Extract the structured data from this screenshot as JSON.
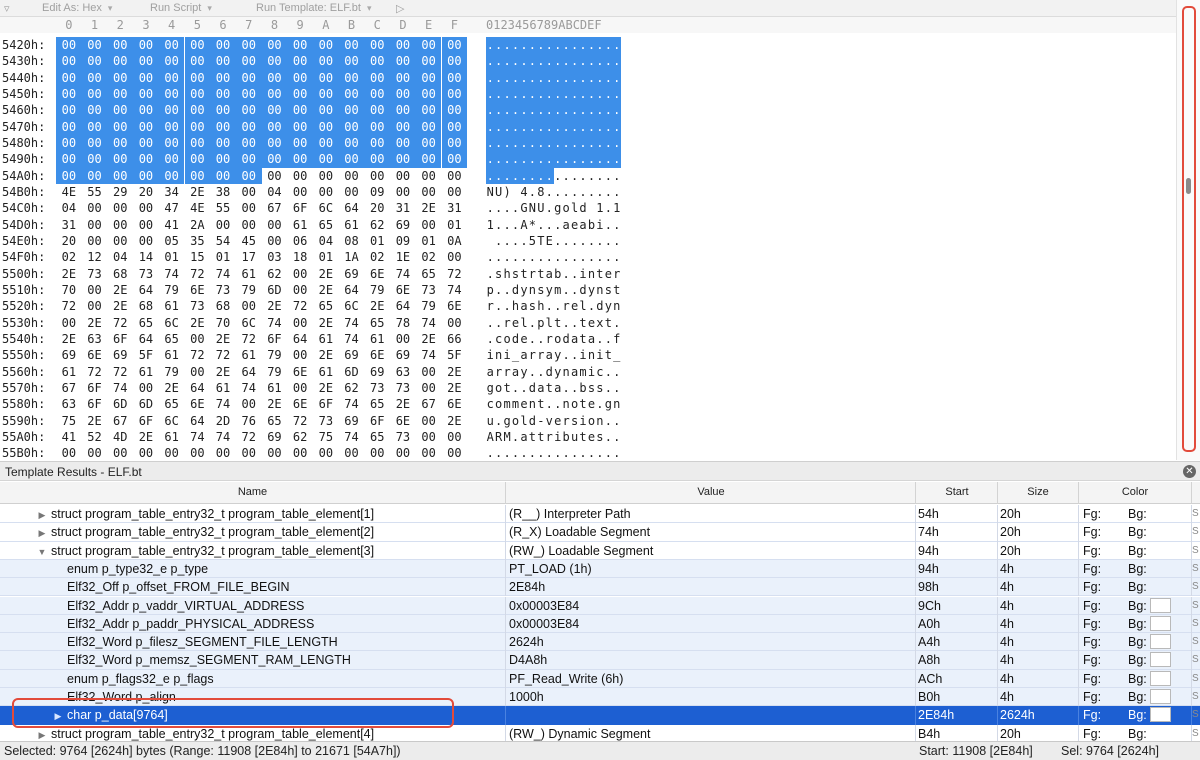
{
  "toolbar": {
    "menu_icon": "menu-arrow-icon",
    "edit_as": "Edit As: Hex",
    "run_script": "Run Script",
    "run_template": "Run Template: ELF.bt",
    "play_icon": "play-icon"
  },
  "hex": {
    "column_headers": [
      "0",
      "1",
      "2",
      "3",
      "4",
      "5",
      "6",
      "7",
      "8",
      "9",
      "A",
      "B",
      "C",
      "D",
      "E",
      "F"
    ],
    "ascii_header": "0123456789ABCDEF",
    "selection_color": "#3d8fe9",
    "rows": [
      {
        "addr": "5420h:",
        "bytes": [
          "00",
          "00",
          "00",
          "00",
          "00",
          "00",
          "00",
          "00",
          "00",
          "00",
          "00",
          "00",
          "00",
          "00",
          "00",
          "00"
        ],
        "ascii": "................",
        "sel_from": 0,
        "sel_to": 16
      },
      {
        "addr": "5430h:",
        "bytes": [
          "00",
          "00",
          "00",
          "00",
          "00",
          "00",
          "00",
          "00",
          "00",
          "00",
          "00",
          "00",
          "00",
          "00",
          "00",
          "00"
        ],
        "ascii": "................",
        "sel_from": 0,
        "sel_to": 16
      },
      {
        "addr": "5440h:",
        "bytes": [
          "00",
          "00",
          "00",
          "00",
          "00",
          "00",
          "00",
          "00",
          "00",
          "00",
          "00",
          "00",
          "00",
          "00",
          "00",
          "00"
        ],
        "ascii": "................",
        "sel_from": 0,
        "sel_to": 16
      },
      {
        "addr": "5450h:",
        "bytes": [
          "00",
          "00",
          "00",
          "00",
          "00",
          "00",
          "00",
          "00",
          "00",
          "00",
          "00",
          "00",
          "00",
          "00",
          "00",
          "00"
        ],
        "ascii": "................",
        "sel_from": 0,
        "sel_to": 16
      },
      {
        "addr": "5460h:",
        "bytes": [
          "00",
          "00",
          "00",
          "00",
          "00",
          "00",
          "00",
          "00",
          "00",
          "00",
          "00",
          "00",
          "00",
          "00",
          "00",
          "00"
        ],
        "ascii": "................",
        "sel_from": 0,
        "sel_to": 16
      },
      {
        "addr": "5470h:",
        "bytes": [
          "00",
          "00",
          "00",
          "00",
          "00",
          "00",
          "00",
          "00",
          "00",
          "00",
          "00",
          "00",
          "00",
          "00",
          "00",
          "00"
        ],
        "ascii": "................",
        "sel_from": 0,
        "sel_to": 16
      },
      {
        "addr": "5480h:",
        "bytes": [
          "00",
          "00",
          "00",
          "00",
          "00",
          "00",
          "00",
          "00",
          "00",
          "00",
          "00",
          "00",
          "00",
          "00",
          "00",
          "00"
        ],
        "ascii": "................",
        "sel_from": 0,
        "sel_to": 16
      },
      {
        "addr": "5490h:",
        "bytes": [
          "00",
          "00",
          "00",
          "00",
          "00",
          "00",
          "00",
          "00",
          "00",
          "00",
          "00",
          "00",
          "00",
          "00",
          "00",
          "00"
        ],
        "ascii": "................",
        "sel_from": 0,
        "sel_to": 16
      },
      {
        "addr": "54A0h:",
        "bytes": [
          "00",
          "00",
          "00",
          "00",
          "00",
          "00",
          "00",
          "00",
          "00",
          "00",
          "00",
          "00",
          "00",
          "00",
          "00",
          "00"
        ],
        "ascii": "................",
        "sel_from": 0,
        "sel_to": 8
      },
      {
        "addr": "54B0h:",
        "bytes": [
          "4E",
          "55",
          "29",
          "20",
          "34",
          "2E",
          "38",
          "00",
          "04",
          "00",
          "00",
          "00",
          "09",
          "00",
          "00",
          "00"
        ],
        "ascii": "NU) 4.8.........",
        "sel_from": 0,
        "sel_to": 0
      },
      {
        "addr": "54C0h:",
        "bytes": [
          "04",
          "00",
          "00",
          "00",
          "47",
          "4E",
          "55",
          "00",
          "67",
          "6F",
          "6C",
          "64",
          "20",
          "31",
          "2E",
          "31"
        ],
        "ascii": "....GNU.gold 1.1",
        "sel_from": 0,
        "sel_to": 0
      },
      {
        "addr": "54D0h:",
        "bytes": [
          "31",
          "00",
          "00",
          "00",
          "41",
          "2A",
          "00",
          "00",
          "00",
          "61",
          "65",
          "61",
          "62",
          "69",
          "00",
          "01"
        ],
        "ascii": "1...A*...aeabi..",
        "sel_from": 0,
        "sel_to": 0
      },
      {
        "addr": "54E0h:",
        "bytes": [
          "20",
          "00",
          "00",
          "00",
          "05",
          "35",
          "54",
          "45",
          "00",
          "06",
          "04",
          "08",
          "01",
          "09",
          "01",
          "0A"
        ],
        "ascii": " ....5TE........",
        "sel_from": 0,
        "sel_to": 0
      },
      {
        "addr": "54F0h:",
        "bytes": [
          "02",
          "12",
          "04",
          "14",
          "01",
          "15",
          "01",
          "17",
          "03",
          "18",
          "01",
          "1A",
          "02",
          "1E",
          "02",
          "00"
        ],
        "ascii": "................",
        "sel_from": 0,
        "sel_to": 0
      },
      {
        "addr": "5500h:",
        "bytes": [
          "2E",
          "73",
          "68",
          "73",
          "74",
          "72",
          "74",
          "61",
          "62",
          "00",
          "2E",
          "69",
          "6E",
          "74",
          "65",
          "72"
        ],
        "ascii": ".shstrtab..inter",
        "sel_from": 0,
        "sel_to": 0
      },
      {
        "addr": "5510h:",
        "bytes": [
          "70",
          "00",
          "2E",
          "64",
          "79",
          "6E",
          "73",
          "79",
          "6D",
          "00",
          "2E",
          "64",
          "79",
          "6E",
          "73",
          "74"
        ],
        "ascii": "p..dynsym..dynst",
        "sel_from": 0,
        "sel_to": 0
      },
      {
        "addr": "5520h:",
        "bytes": [
          "72",
          "00",
          "2E",
          "68",
          "61",
          "73",
          "68",
          "00",
          "2E",
          "72",
          "65",
          "6C",
          "2E",
          "64",
          "79",
          "6E"
        ],
        "ascii": "r..hash..rel.dyn",
        "sel_from": 0,
        "sel_to": 0
      },
      {
        "addr": "5530h:",
        "bytes": [
          "00",
          "2E",
          "72",
          "65",
          "6C",
          "2E",
          "70",
          "6C",
          "74",
          "00",
          "2E",
          "74",
          "65",
          "78",
          "74",
          "00"
        ],
        "ascii": "..rel.plt..text.",
        "sel_from": 0,
        "sel_to": 0
      },
      {
        "addr": "5540h:",
        "bytes": [
          "2E",
          "63",
          "6F",
          "64",
          "65",
          "00",
          "2E",
          "72",
          "6F",
          "64",
          "61",
          "74",
          "61",
          "00",
          "2E",
          "66"
        ],
        "ascii": ".code..rodata..f",
        "sel_from": 0,
        "sel_to": 0
      },
      {
        "addr": "5550h:",
        "bytes": [
          "69",
          "6E",
          "69",
          "5F",
          "61",
          "72",
          "72",
          "61",
          "79",
          "00",
          "2E",
          "69",
          "6E",
          "69",
          "74",
          "5F"
        ],
        "ascii": "ini_array..init_",
        "sel_from": 0,
        "sel_to": 0
      },
      {
        "addr": "5560h:",
        "bytes": [
          "61",
          "72",
          "72",
          "61",
          "79",
          "00",
          "2E",
          "64",
          "79",
          "6E",
          "61",
          "6D",
          "69",
          "63",
          "00",
          "2E"
        ],
        "ascii": "array..dynamic..",
        "sel_from": 0,
        "sel_to": 0
      },
      {
        "addr": "5570h:",
        "bytes": [
          "67",
          "6F",
          "74",
          "00",
          "2E",
          "64",
          "61",
          "74",
          "61",
          "00",
          "2E",
          "62",
          "73",
          "73",
          "00",
          "2E"
        ],
        "ascii": "got..data..bss..",
        "sel_from": 0,
        "sel_to": 0
      },
      {
        "addr": "5580h:",
        "bytes": [
          "63",
          "6F",
          "6D",
          "6D",
          "65",
          "6E",
          "74",
          "00",
          "2E",
          "6E",
          "6F",
          "74",
          "65",
          "2E",
          "67",
          "6E"
        ],
        "ascii": "comment..note.gn",
        "sel_from": 0,
        "sel_to": 0
      },
      {
        "addr": "5590h:",
        "bytes": [
          "75",
          "2E",
          "67",
          "6F",
          "6C",
          "64",
          "2D",
          "76",
          "65",
          "72",
          "73",
          "69",
          "6F",
          "6E",
          "00",
          "2E"
        ],
        "ascii": "u.gold-version..",
        "sel_from": 0,
        "sel_to": 0
      },
      {
        "addr": "55A0h:",
        "bytes": [
          "41",
          "52",
          "4D",
          "2E",
          "61",
          "74",
          "74",
          "72",
          "69",
          "62",
          "75",
          "74",
          "65",
          "73",
          "00",
          "00"
        ],
        "ascii": "ARM.attributes..",
        "sel_from": 0,
        "sel_to": 0
      },
      {
        "addr": "55B0h:",
        "bytes": [
          "00",
          "00",
          "00",
          "00",
          "00",
          "00",
          "00",
          "00",
          "00",
          "00",
          "00",
          "00",
          "00",
          "00",
          "00",
          "00"
        ],
        "ascii": "................",
        "sel_from": 0,
        "sel_to": 0
      }
    ]
  },
  "results": {
    "title": "Template Results - ELF.bt",
    "close_icon": "close-icon",
    "columns": {
      "name": "Name",
      "value": "Value",
      "start": "Start",
      "size": "Size",
      "color": "Color"
    },
    "rows": [
      {
        "indent": 0,
        "expander": "collapsed",
        "name": "struct program_table_entry32_t program_table_element[1]",
        "value": "(R__) Interpreter Path",
        "start": "54h",
        "size": "20h",
        "fg": "Fg:",
        "bg": "Bg:",
        "swatch": false,
        "selected": false,
        "alt": false
      },
      {
        "indent": 0,
        "expander": "collapsed",
        "name": "struct program_table_entry32_t program_table_element[2]",
        "value": "(R_X) Loadable Segment",
        "start": "74h",
        "size": "20h",
        "fg": "Fg:",
        "bg": "Bg:",
        "swatch": false,
        "selected": false,
        "alt": false
      },
      {
        "indent": 0,
        "expander": "expanded",
        "name": "struct program_table_entry32_t program_table_element[3]",
        "value": "(RW_) Loadable Segment",
        "start": "94h",
        "size": "20h",
        "fg": "Fg:",
        "bg": "Bg:",
        "swatch": false,
        "selected": false,
        "alt": false
      },
      {
        "indent": 1,
        "expander": "none",
        "name": "enum p_type32_e p_type",
        "value": "PT_LOAD (1h)",
        "start": "94h",
        "size": "4h",
        "fg": "Fg:",
        "bg": "Bg:",
        "swatch": false,
        "selected": false,
        "alt": true
      },
      {
        "indent": 1,
        "expander": "none",
        "name": "Elf32_Off p_offset_FROM_FILE_BEGIN",
        "value": "2E84h",
        "start": "98h",
        "size": "4h",
        "fg": "Fg:",
        "bg": "Bg:",
        "swatch": false,
        "selected": false,
        "alt": true
      },
      {
        "indent": 1,
        "expander": "none",
        "name": "Elf32_Addr p_vaddr_VIRTUAL_ADDRESS",
        "value": "0x00003E84",
        "start": "9Ch",
        "size": "4h",
        "fg": "Fg:",
        "bg": "Bg:",
        "swatch": true,
        "selected": false,
        "alt": true
      },
      {
        "indent": 1,
        "expander": "none",
        "name": "Elf32_Addr p_paddr_PHYSICAL_ADDRESS",
        "value": "0x00003E84",
        "start": "A0h",
        "size": "4h",
        "fg": "Fg:",
        "bg": "Bg:",
        "swatch": true,
        "selected": false,
        "alt": true
      },
      {
        "indent": 1,
        "expander": "none",
        "name": "Elf32_Word p_filesz_SEGMENT_FILE_LENGTH",
        "value": "2624h",
        "start": "A4h",
        "size": "4h",
        "fg": "Fg:",
        "bg": "Bg:",
        "swatch": true,
        "selected": false,
        "alt": true
      },
      {
        "indent": 1,
        "expander": "none",
        "name": "Elf32_Word p_memsz_SEGMENT_RAM_LENGTH",
        "value": "D4A8h",
        "start": "A8h",
        "size": "4h",
        "fg": "Fg:",
        "bg": "Bg:",
        "swatch": true,
        "selected": false,
        "alt": true
      },
      {
        "indent": 1,
        "expander": "none",
        "name": "enum p_flags32_e p_flags",
        "value": "PF_Read_Write (6h)",
        "start": "ACh",
        "size": "4h",
        "fg": "Fg:",
        "bg": "Bg:",
        "swatch": true,
        "selected": false,
        "alt": true
      },
      {
        "indent": 1,
        "expander": "none",
        "name": "Elf32_Word p_align",
        "value": "1000h",
        "start": "B0h",
        "size": "4h",
        "fg": "Fg:",
        "bg": "Bg:",
        "swatch": true,
        "selected": false,
        "alt": true
      },
      {
        "indent": 1,
        "expander": "collapsed",
        "name": "char p_data[9764]",
        "value": "",
        "start": "2E84h",
        "size": "2624h",
        "fg": "Fg:",
        "bg": "Bg:",
        "swatch": true,
        "selected": true,
        "alt": true
      },
      {
        "indent": 0,
        "expander": "collapsed",
        "name": "struct program_table_entry32_t program_table_element[4]",
        "value": "(RW_) Dynamic Segment",
        "start": "B4h",
        "size": "20h",
        "fg": "Fg:",
        "bg": "Bg:",
        "swatch": false,
        "selected": false,
        "alt": false
      }
    ]
  },
  "status": {
    "selected": "Selected: 9764 [2624h] bytes (Range: 11908 [2E84h] to 21671 [54A7h])",
    "start": "Start: 11908 [2E84h]",
    "sel": "Sel: 9764 [2624h]"
  },
  "colors": {
    "hex_selection": "#3d8fe9",
    "row_selection": "#1d5fd2",
    "callout_red": "#e24b3b"
  }
}
